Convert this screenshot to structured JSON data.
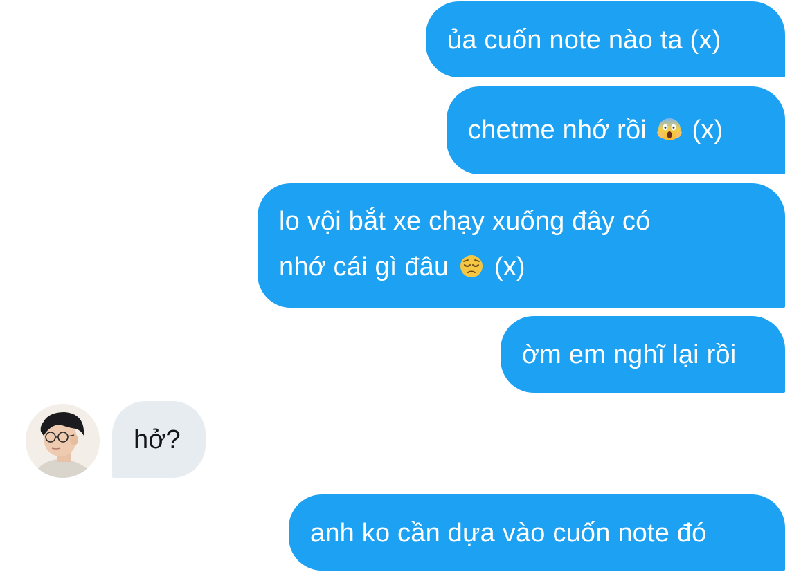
{
  "conversation": {
    "messages": [
      {
        "direction": "outgoing",
        "text": "ủa cuốn note nào ta (x)"
      },
      {
        "direction": "outgoing",
        "text_before": "chetme nhớ rồi",
        "emoji": "face-screaming-in-fear-icon",
        "text_after": "(x)"
      },
      {
        "direction": "outgoing",
        "line1": "lo vội bắt xe chạy xuống đây có",
        "line2_before": "nhớ cái gì đâu",
        "emoji": "pensive-face-icon",
        "line2_after": "(x)"
      },
      {
        "direction": "outgoing",
        "text": "ờm em nghĩ lại rồi"
      },
      {
        "direction": "incoming",
        "text": "hở?"
      },
      {
        "direction": "outgoing",
        "text": "anh ko cần dựa vào cuốn note đó"
      }
    ]
  },
  "colors": {
    "outgoing_bubble": "#1da1f2",
    "incoming_bubble": "#e6ecf0",
    "outgoing_text": "#ffffff",
    "incoming_text": "#14171a"
  }
}
